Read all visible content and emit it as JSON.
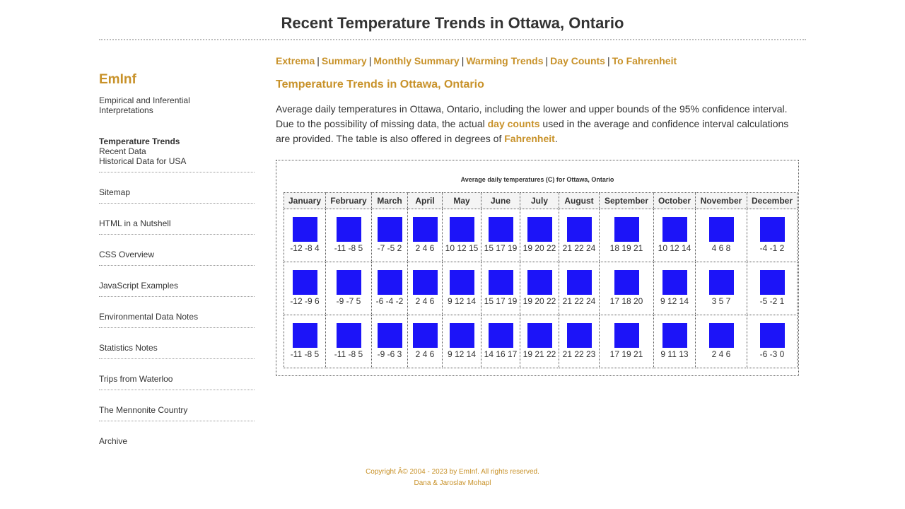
{
  "page": {
    "title": "Recent Temperature Trends in Ottawa, Ontario"
  },
  "sidebar": {
    "brand": "EmInf",
    "tagline": "Empirical and Inferential Interpretations",
    "section": {
      "current": "Temperature Trends",
      "items": [
        "Recent Data",
        "Historical Data for USA"
      ]
    },
    "links": [
      "Sitemap",
      "HTML in a Nutshell",
      "CSS Overview",
      "JavaScript Examples",
      "Environmental Data Notes",
      "Statistics Notes",
      "Trips from Waterloo",
      "The Mennonite Country",
      "Archive"
    ]
  },
  "topnav": {
    "links": [
      "Extrema",
      "Summary",
      "Monthly Summary",
      "Warming Trends",
      "Day Counts",
      "To Fahrenheit"
    ],
    "separator": "|"
  },
  "main": {
    "heading": "Temperature Trends in Ottawa, Ontario",
    "intro": {
      "part1": "Average daily temperatures in Ottawa, Ontario, including the lower and upper bounds of the 95% confidence interval. Due to the possibility of missing data, the actual ",
      "link1": "day counts",
      "part2": " used in the average and confidence interval calculations are provided. The table is also offered in degrees of ",
      "link2": "Fahrenheit",
      "part3": "."
    }
  },
  "table": {
    "caption": "Average daily temperatures (C) for Ottawa, Ontario",
    "square_color": "#1c14f8",
    "months": [
      "January",
      "February",
      "March",
      "April",
      "May",
      "June",
      "July",
      "August",
      "September",
      "October",
      "November",
      "December"
    ],
    "rows": [
      [
        "-12 -8 4",
        "-11 -8 5",
        "-7 -5 2",
        "2 4 6",
        "10 12 15",
        "15 17 19",
        "19 20 22",
        "21 22 24",
        "18 19 21",
        "10 12 14",
        "4 6 8",
        "-4 -1 2"
      ],
      [
        "-12 -9 6",
        "-9 -7 5",
        "-6 -4 -2",
        "2 4 6",
        "9 12 14",
        "15 17 19",
        "19 20 22",
        "21 22 24",
        "17 18 20",
        "9 12 14",
        "3 5 7",
        "-5 -2 1"
      ],
      [
        "-11 -8 5",
        "-11 -8 5",
        "-9 -6 3",
        "2 4 6",
        "9 12 14",
        "14 16 17",
        "19 21 22",
        "21 22 23",
        "17 19 21",
        "9 11 13",
        "2 4 6",
        "-6 -3 0"
      ]
    ]
  },
  "footer": {
    "copyright": "Copyright Â© 2004 - 2023 by EmInf. All rights reserved.",
    "authors": "Dana & Jaroslav Mohapl"
  },
  "colors": {
    "accent": "#c8922a",
    "text": "#333333",
    "square": "#1c14f8"
  }
}
